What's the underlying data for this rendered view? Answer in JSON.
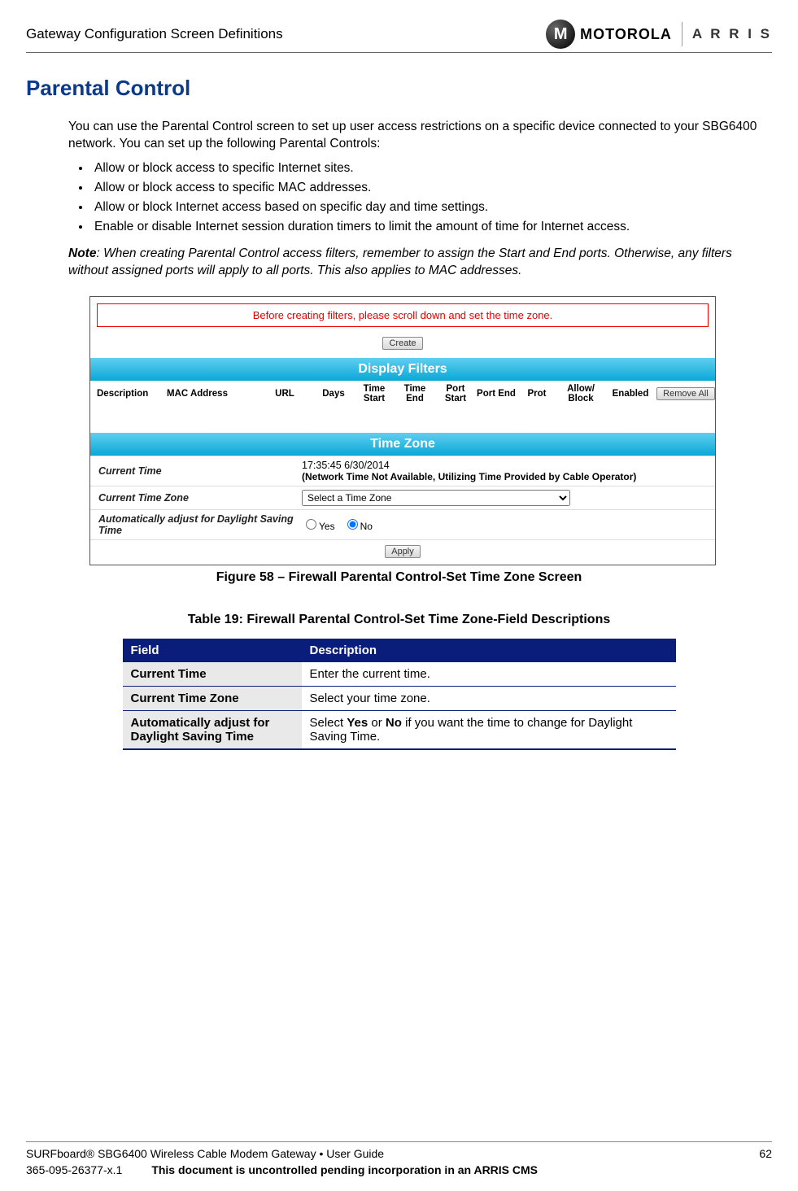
{
  "header": {
    "chapter": "Gateway Configuration Screen Definitions",
    "logo_moto_glyph": "M",
    "logo_moto_word": "MOTOROLA",
    "logo_arris_word": "A R R I S"
  },
  "title": "Parental Control",
  "intro": "You can use the Parental Control screen to set up user access restrictions on a specific device connected to your SBG6400 network. You can set up the following Parental Controls:",
  "bullets": [
    "Allow or block access to specific Internet sites.",
    "Allow or block access to specific MAC addresses.",
    "Allow or block Internet access based on specific day and time settings.",
    "Enable or disable Internet session duration timers to limit the amount of time for Internet access."
  ],
  "note_lead": "Note",
  "note_body": ": When creating Parental Control access filters, remember to assign the Start and End ports. Otherwise, any filters without assigned ports will apply to all ports. This also applies to MAC addresses.",
  "screenshot": {
    "warning": "Before creating filters, please scroll down and set the time zone.",
    "create_btn": "Create",
    "display_filters_title": "Display Filters",
    "columns": [
      "Description",
      "MAC Address",
      "URL",
      "Days",
      "Time Start",
      "Time End",
      "Port Start",
      "Port End",
      "Prot",
      "Allow/ Block",
      "Enabled",
      ""
    ],
    "remove_all_btn": "Remove All",
    "time_zone_title": "Time Zone",
    "tz_rows": {
      "current_time_label": "Current Time",
      "current_time_value": "17:35:45 6/30/2014",
      "nt_note": "(Network Time Not Available, Utilizing Time Provided by Cable Operator)",
      "current_tz_label": "Current Time Zone",
      "tz_select_value": "Select a Time Zone",
      "dst_label": "Automatically adjust for Daylight Saving Time",
      "dst_yes": "Yes",
      "dst_no": "No"
    },
    "apply_btn": "Apply"
  },
  "figure_caption": "Figure 58 – Firewall Parental Control-Set Time Zone Screen",
  "table_caption": "Table 19: Firewall Parental Control-Set Time Zone-Field Descriptions",
  "fd_table": {
    "head_field": "Field",
    "head_desc": "Description",
    "rows": [
      {
        "field": "Current Time",
        "desc_pre": "Enter the current time.",
        "desc_bold1": "",
        "desc_mid": "",
        "desc_bold2": "",
        "desc_post": ""
      },
      {
        "field": "Current Time Zone",
        "desc_pre": "Select your time zone.",
        "desc_bold1": "",
        "desc_mid": "",
        "desc_bold2": "",
        "desc_post": ""
      },
      {
        "field": "Automatically adjust for Daylight Saving Time",
        "desc_pre": "Select ",
        "desc_bold1": "Yes",
        "desc_mid": " or ",
        "desc_bold2": "No",
        "desc_post": " if you want the time to change for Daylight Saving Time."
      }
    ]
  },
  "footer": {
    "guide": "SURFboard® SBG6400 Wireless Cable Modem Gateway • User Guide",
    "page": "62",
    "docnum": "365-095-26377-x.1",
    "uncontrolled": "This document is uncontrolled pending incorporation in an ARRIS CMS"
  }
}
